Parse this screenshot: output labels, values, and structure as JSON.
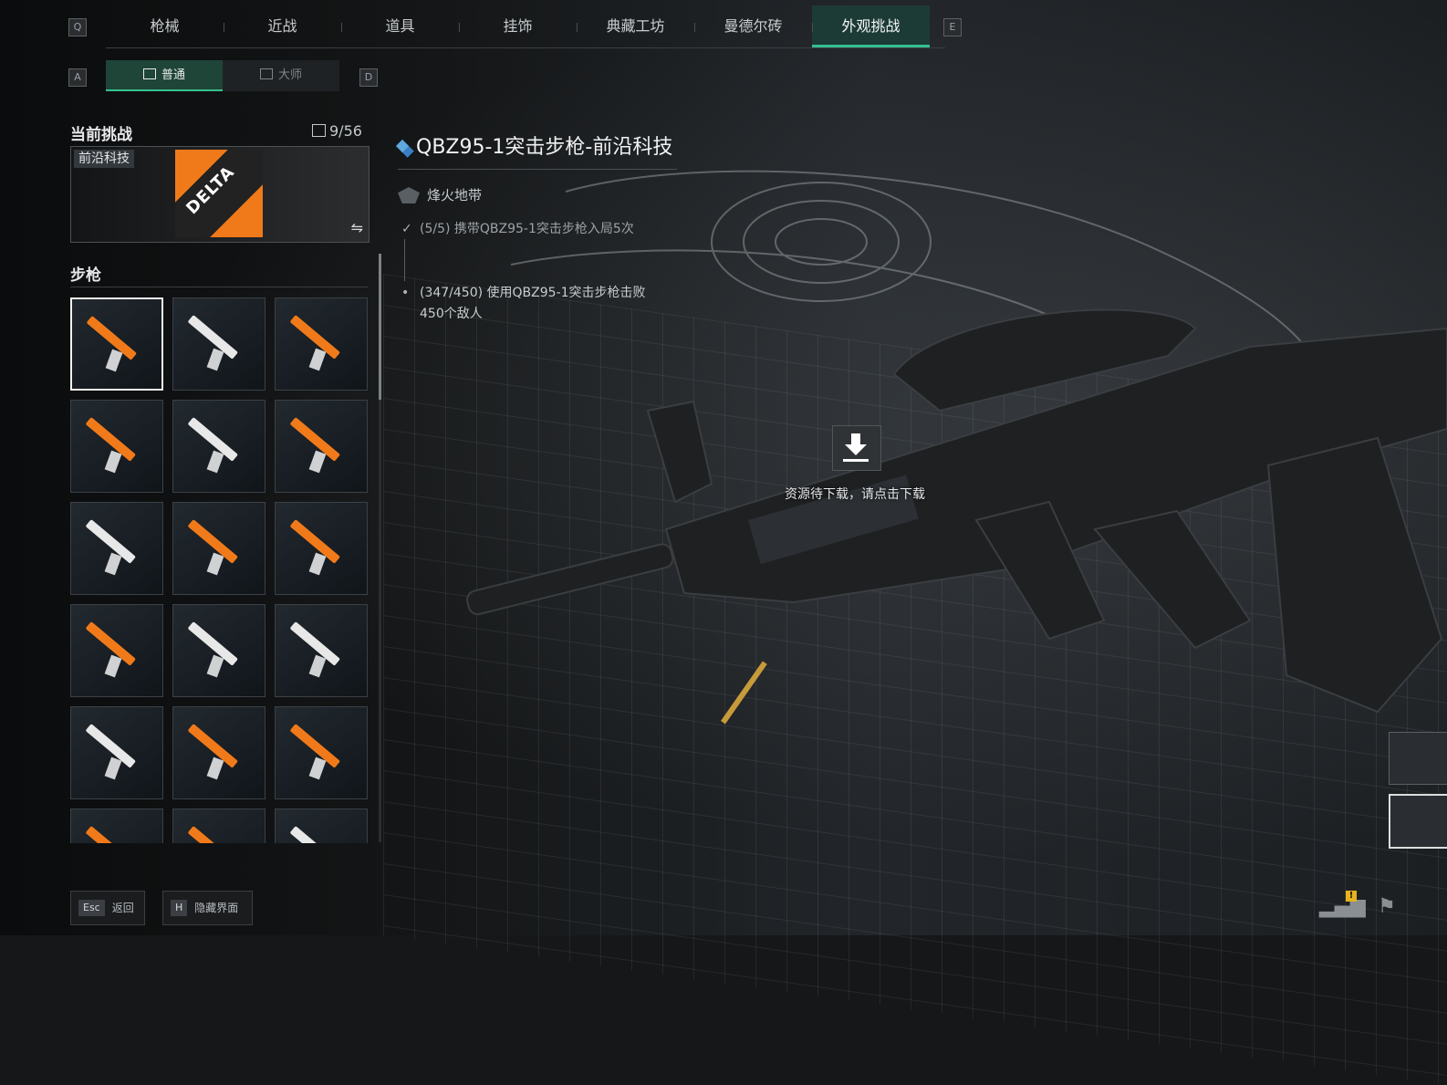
{
  "top_nav": {
    "prev_key": "Q",
    "next_key": "E",
    "tabs": [
      {
        "label": "枪械",
        "active": false
      },
      {
        "label": "近战",
        "active": false
      },
      {
        "label": "道具",
        "active": false
      },
      {
        "label": "挂饰",
        "active": false
      },
      {
        "label": "典藏工坊",
        "active": false
      },
      {
        "label": "曼德尔砖",
        "active": false
      },
      {
        "label": "外观挑战",
        "active": true
      }
    ]
  },
  "sub_nav": {
    "prev_key": "A",
    "next_key": "D",
    "tabs": [
      {
        "label": "普通",
        "active": true
      },
      {
        "label": "大师",
        "active": false
      }
    ]
  },
  "current_challenge": {
    "heading": "当前挑战",
    "progress": "9/56",
    "card_tag": "前沿科技",
    "logo_text": "DELTA"
  },
  "category": {
    "heading": "步枪",
    "skins_visible": 18,
    "selected_index": 0
  },
  "detail": {
    "title": "QBZ95-1突击步枪-前沿科技",
    "mode": "烽火地带",
    "tasks": [
      {
        "text": "(5/5) 携带QBZ95-1突击步枪入局5次",
        "done": true
      },
      {
        "text": "(347/450) 使用QBZ95-1突击步枪击败450个敌人",
        "done": false
      }
    ]
  },
  "download": {
    "prompt": "资源待下载，请点击下载"
  },
  "footer": {
    "back_key": "Esc",
    "back_label": "返回",
    "hide_key": "H",
    "hide_label": "隐藏界面",
    "alert": "!"
  },
  "colors": {
    "accent": "#36c08f",
    "active_tab_bg": "#1d3b36",
    "brand_orange": "#f07a1a",
    "alert": "#e6b21e"
  }
}
